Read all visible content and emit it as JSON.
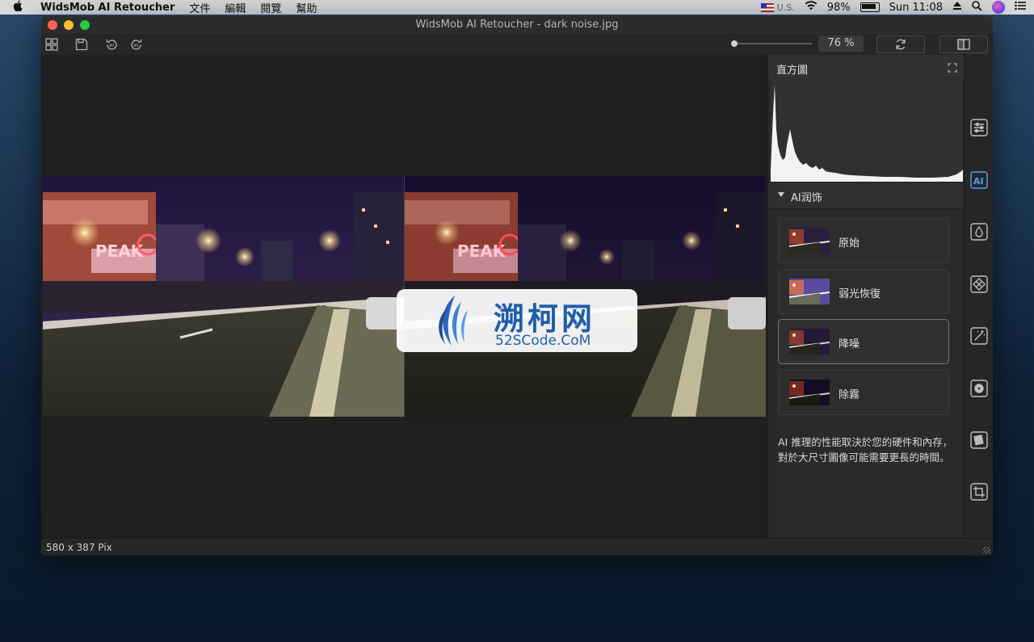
{
  "menubar": {
    "app_name": "WidsMob AI Retoucher",
    "menus": [
      "文件",
      "編輯",
      "閱覽",
      "幫助"
    ],
    "input_source": "U.S.",
    "battery": "98%",
    "clock": "Sun 11:08"
  },
  "window": {
    "title": "WidsMob AI Retoucher - dark noise.jpg"
  },
  "toolbar": {
    "zoom_percent": "76 %",
    "zoom_level": 0.0
  },
  "panel": {
    "histogram_title": "直方圖",
    "ai_section_title": "AI润饰",
    "presets": [
      {
        "label": "原始",
        "selected": false
      },
      {
        "label": "弱光恢復",
        "selected": false
      },
      {
        "label": "降噪",
        "selected": true
      },
      {
        "label": "除霧",
        "selected": false
      }
    ],
    "note": "AI 推理的性能取決於您的硬件和內存，對於大尺寸圖像可能需要更長的時間。"
  },
  "status": {
    "dimensions": "580 x 387 Pix"
  },
  "watermark": {
    "cn": "溯柯网",
    "en": "52SCode.CoM"
  },
  "colors": {
    "accent": "#4ea0ff",
    "window_bg": "#232323",
    "panel_bg": "#2a2a2a"
  }
}
